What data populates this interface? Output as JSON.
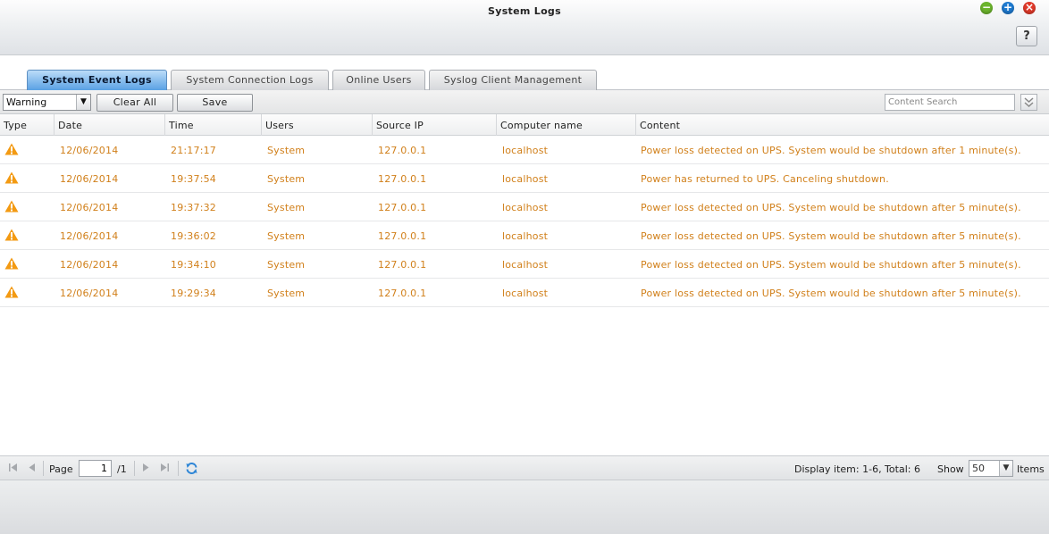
{
  "window": {
    "title": "System Logs",
    "help_label": "?",
    "minimize_glyph": "−",
    "maximize_glyph": "+",
    "close_glyph": "×"
  },
  "tabs": [
    {
      "label": "System Event Logs",
      "active": true
    },
    {
      "label": "System Connection Logs",
      "active": false
    },
    {
      "label": "Online Users",
      "active": false
    },
    {
      "label": "Syslog Client Management",
      "active": false
    }
  ],
  "toolbar": {
    "filter_value": "Warning",
    "clear_label": "Clear All",
    "save_label": "Save",
    "search_placeholder": "Content Search"
  },
  "table": {
    "columns": [
      "Type",
      "Date",
      "Time",
      "Users",
      "Source IP",
      "Computer name",
      "Content"
    ],
    "rows": [
      {
        "type": "warning-icon",
        "date": "12/06/2014",
        "time": "21:17:17",
        "user": "System",
        "ip": "127.0.0.1",
        "computer": "localhost",
        "content": "Power loss detected on UPS. System would be shutdown after 1 minute(s)."
      },
      {
        "type": "warning-icon",
        "date": "12/06/2014",
        "time": "19:37:54",
        "user": "System",
        "ip": "127.0.0.1",
        "computer": "localhost",
        "content": "Power has returned to UPS. Canceling shutdown."
      },
      {
        "type": "warning-icon",
        "date": "12/06/2014",
        "time": "19:37:32",
        "user": "System",
        "ip": "127.0.0.1",
        "computer": "localhost",
        "content": "Power loss detected on UPS. System would be shutdown after 5 minute(s)."
      },
      {
        "type": "warning-icon",
        "date": "12/06/2014",
        "time": "19:36:02",
        "user": "System",
        "ip": "127.0.0.1",
        "computer": "localhost",
        "content": "Power loss detected on UPS. System would be shutdown after 5 minute(s)."
      },
      {
        "type": "warning-icon",
        "date": "12/06/2014",
        "time": "19:34:10",
        "user": "System",
        "ip": "127.0.0.1",
        "computer": "localhost",
        "content": "Power loss detected on UPS. System would be shutdown after 5 minute(s)."
      },
      {
        "type": "warning-icon",
        "date": "12/06/2014",
        "time": "19:29:34",
        "user": "System",
        "ip": "127.0.0.1",
        "computer": "localhost",
        "content": "Power loss detected on UPS. System would be shutdown after 5 minute(s)."
      }
    ]
  },
  "pager": {
    "page_label": "Page",
    "page_value": "1",
    "total_pages": "/1",
    "display_text": "Display item: 1-6, Total: 6",
    "show_label": "Show",
    "show_value": "50",
    "items_label": "Items"
  },
  "colors": {
    "row_text": "#d1801b",
    "warning_icon": "#f39a12",
    "active_tab": "#5aa1e4"
  }
}
